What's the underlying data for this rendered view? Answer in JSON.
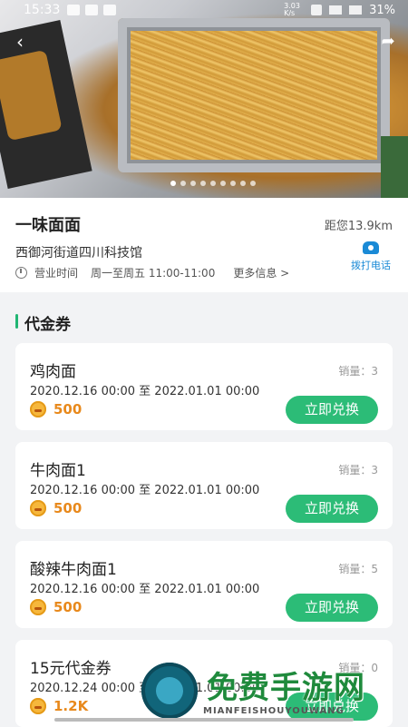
{
  "status_bar": {
    "time": "15:33",
    "network": "3.03 K/s",
    "battery": "31%"
  },
  "carousel": {
    "count": 9,
    "active_index": 0
  },
  "store": {
    "name": "一味面面",
    "distance": "距您13.9km",
    "address": "西御河街道四川科技馆",
    "hours_label": "营业时间",
    "hours_value": "周一至周五 11:00-11:00",
    "more_info": "更多信息 >",
    "call_label": "拨打电话"
  },
  "section": {
    "title": "代金券"
  },
  "vouchers": [
    {
      "title": "鸡肉面",
      "sales": "销量：3",
      "dates": "2020.12.16 00:00 至 2022.01.01 00:00",
      "price": "500",
      "button": "立即兑换"
    },
    {
      "title": "牛肉面1",
      "sales": "销量：3",
      "dates": "2020.12.16 00:00 至 2022.01.01 00:00",
      "price": "500",
      "button": "立即兑换"
    },
    {
      "title": "酸辣牛肉面1",
      "sales": "销量：5",
      "dates": "2020.12.16 00:00 至 2022.01.01 00:00",
      "price": "500",
      "button": "立即兑换"
    },
    {
      "title": "15元代金券",
      "sales": "销量：0",
      "dates": "2020.12.24 00:00 至 2022.01.01 00:00",
      "price": "1.2K",
      "button": "立即兑换"
    }
  ],
  "watermark": {
    "text": "免费手游网",
    "sub": "MIANFEISHOUYOUWANG"
  },
  "colors": {
    "accent_green": "#2cbc77",
    "call_blue": "#1a8ad6",
    "price_orange": "#e8891c"
  }
}
